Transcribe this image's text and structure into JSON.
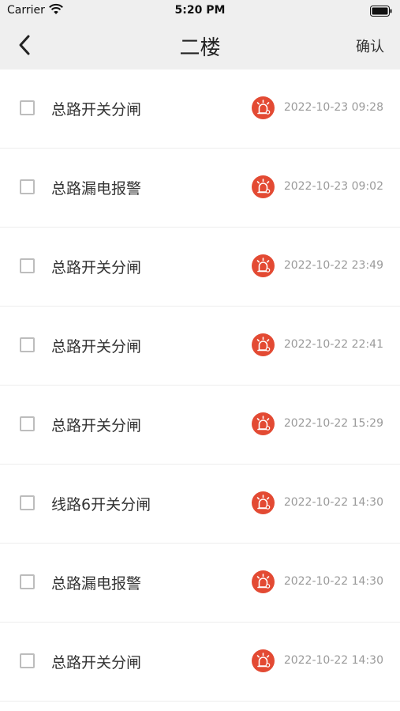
{
  "status_bar": {
    "carrier": "Carrier",
    "time": "5:20 PM"
  },
  "nav": {
    "title": "二楼",
    "confirm_label": "确认"
  },
  "colors": {
    "alarm": "#e34a33",
    "nav_bg": "#efefef"
  },
  "alarms": [
    {
      "label": "总路开关分闸",
      "time": "2022-10-23 09:28"
    },
    {
      "label": "总路漏电报警",
      "time": "2022-10-23 09:02"
    },
    {
      "label": "总路开关分闸",
      "time": "2022-10-22 23:49"
    },
    {
      "label": "总路开关分闸",
      "time": "2022-10-22 22:41"
    },
    {
      "label": "总路开关分闸",
      "time": "2022-10-22 15:29"
    },
    {
      "label": "线路6开关分闸",
      "time": "2022-10-22 14:30"
    },
    {
      "label": "总路漏电报警",
      "time": "2022-10-22 14:30"
    },
    {
      "label": "总路开关分闸",
      "time": "2022-10-22 14:30"
    }
  ]
}
